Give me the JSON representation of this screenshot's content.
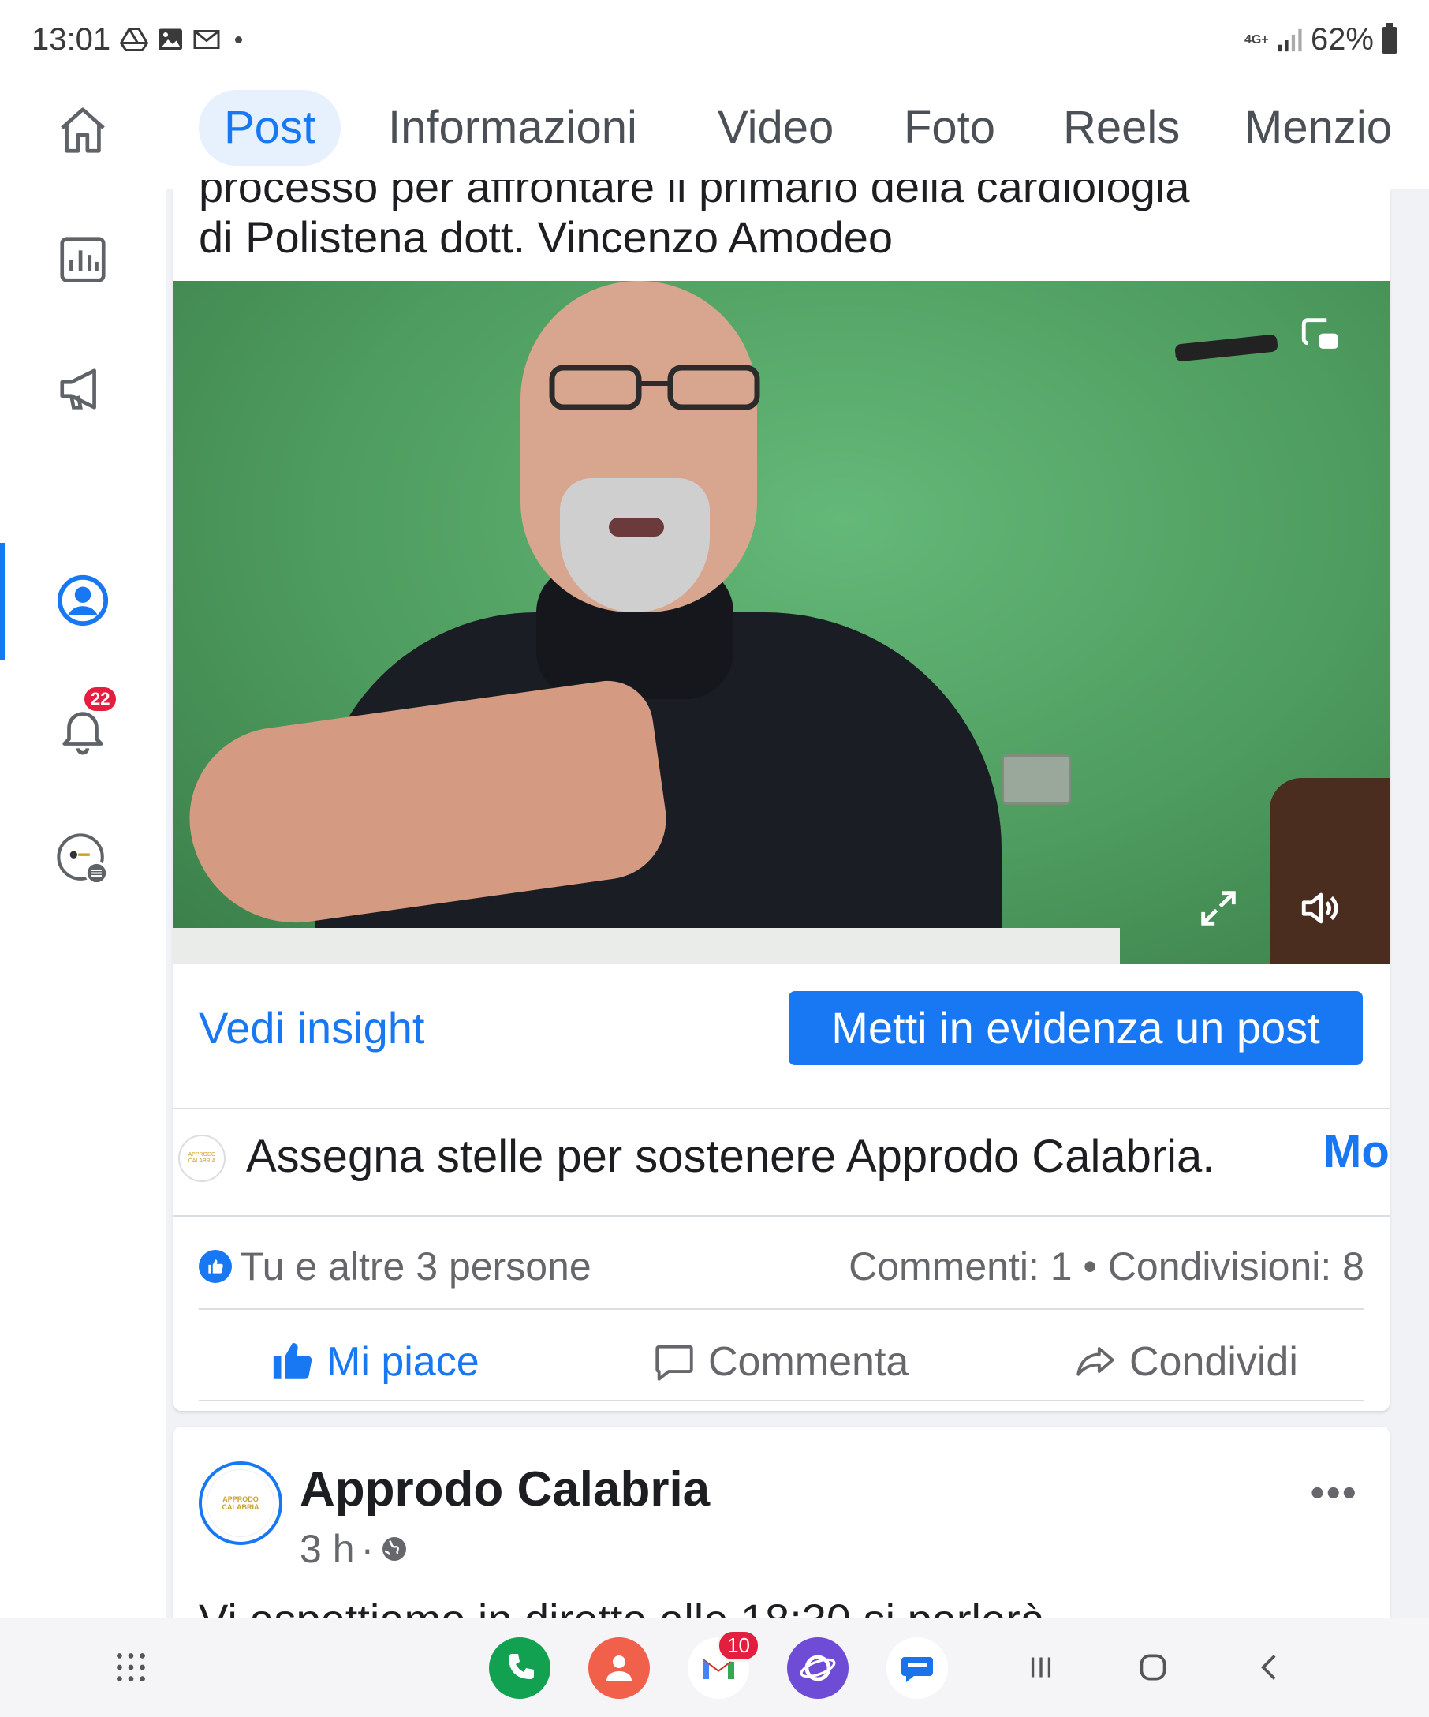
{
  "status_bar": {
    "time": "13:01",
    "network": "4G+",
    "battery": "62%"
  },
  "rail": {
    "notifications_badge": "22"
  },
  "tabs": [
    {
      "label": "Post"
    },
    {
      "label": "Informazioni"
    },
    {
      "label": "Video"
    },
    {
      "label": "Foto"
    },
    {
      "label": "Reels"
    },
    {
      "label": "Menzio"
    }
  ],
  "post1": {
    "caption_cut": "processo per affrontare il primario della cardiologia",
    "caption": "di Polistena dott. Vincenzo Amodeo",
    "insight_label": "Vedi insight",
    "boost_label": "Metti in evidenza un post",
    "stars_text": "Assegna stelle per sostenere Approdo Calabria.",
    "stars_more": "Mo",
    "reactions_text": "Tu e altre 3 persone",
    "counts_text": "Commenti: 1 • Condivisioni: 8",
    "actions": {
      "like": "Mi piace",
      "comment": "Commenta",
      "share": "Condividi"
    }
  },
  "post2": {
    "page_name": "Approdo Calabria",
    "time": "3 h",
    "separator": "·",
    "more": "•••",
    "text_cut": "Vi aspettiamo in diretta alle 18:30 si parlerà ..."
  },
  "avatar_logo_text": "APPRODO CALABRIA",
  "dock": {
    "gmail_badge": "10"
  },
  "colors": {
    "accent": "#1877f2",
    "badge": "#e41e3f",
    "text": "#1c1e21",
    "secondary_text": "#65676b"
  }
}
